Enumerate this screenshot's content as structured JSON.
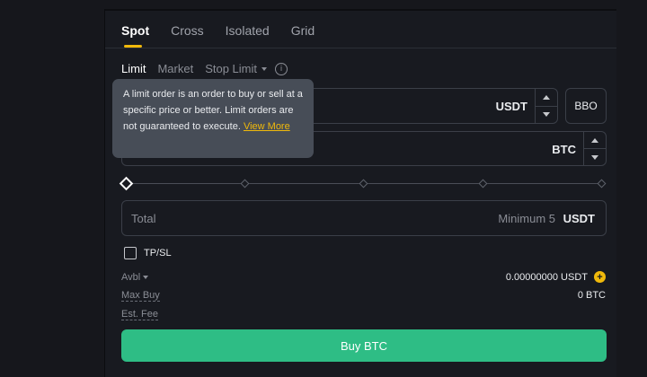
{
  "tabs": [
    {
      "label": "Spot",
      "active": true
    },
    {
      "label": "Cross",
      "active": false
    },
    {
      "label": "Isolated",
      "active": false
    },
    {
      "label": "Grid",
      "active": false
    }
  ],
  "order_types": {
    "limit": "Limit",
    "market": "Market",
    "stop_limit": "Stop Limit"
  },
  "price_field": {
    "unit": "USDT"
  },
  "bbo_label": "BBO",
  "amount_field": {
    "unit": "BTC"
  },
  "total_field": {
    "label": "Total",
    "minimum": "Minimum 5",
    "unit": "USDT"
  },
  "tpsl_label": "TP/SL",
  "avbl": {
    "label": "Avbl",
    "value": "0.00000000 USDT"
  },
  "max_buy": {
    "label": "Max Buy",
    "value": "0 BTC"
  },
  "est_fee": {
    "label": "Est. Fee"
  },
  "buy_button": "Buy BTC",
  "tooltip": {
    "text": "A limit order is an order to buy or sell at a specific price or better. Limit orders are not guaranteed to execute.",
    "link": "View More"
  },
  "slider": {
    "value_percent": 0,
    "marks": [
      0,
      25,
      50,
      75,
      100
    ]
  },
  "colors": {
    "accent": "#f0b90b",
    "buy": "#2ebd85",
    "background": "#181a20"
  },
  "icons": {
    "info": "info-icon",
    "add": "plus-circle-icon"
  }
}
